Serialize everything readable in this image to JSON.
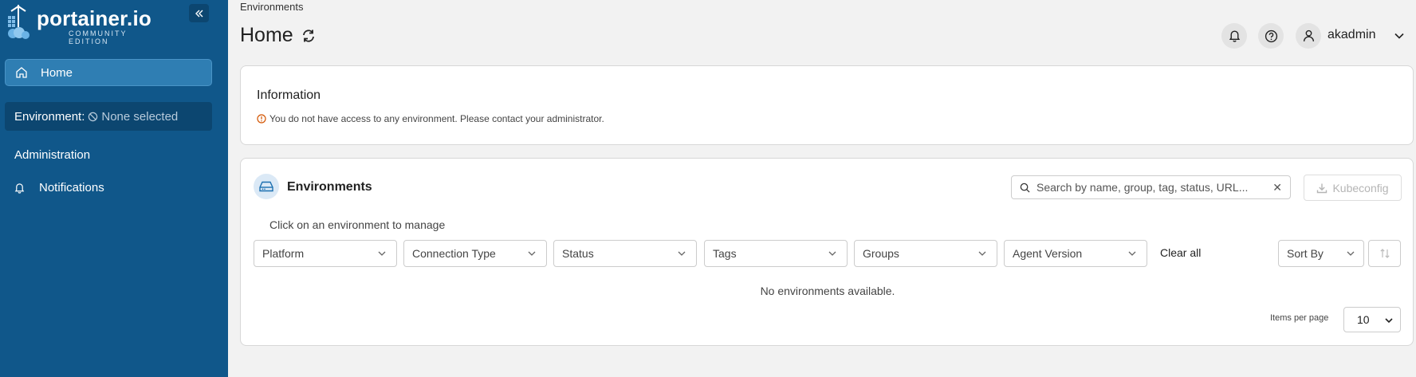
{
  "app": {
    "logo_text": "portainer.io",
    "logo_sub": "COMMUNITY EDITION"
  },
  "colors": {
    "sidebar_bg": "#10578a",
    "sidebar_active": "#2f7eb3",
    "env_box_bg": "#0c4670",
    "page_bg": "#f2f2f2",
    "card_bg": "#ffffff",
    "warning": "#d35400"
  },
  "sidebar": {
    "collapse_icon": "chevrons-left-icon",
    "home": {
      "label": "Home",
      "icon": "home-icon"
    },
    "environment": {
      "label": "Environment:",
      "value": "None selected",
      "icon": "ban-icon"
    },
    "admin_title": "Administration",
    "notifications": {
      "label": "Notifications",
      "icon": "bell-icon"
    }
  },
  "header": {
    "breadcrumb": "Environments",
    "title": "Home",
    "refresh_icon": "refresh-icon",
    "username": "akadmin",
    "icons": [
      "bell-icon",
      "help-icon",
      "user-icon",
      "chevron-down-icon"
    ]
  },
  "info_card": {
    "title": "Information",
    "message": "You do not have access to any environment. Please contact your administrator."
  },
  "environments": {
    "title": "Environments",
    "search_placeholder": "Search by name, group, tag, status, URL...",
    "kubeconfig_label": "Kubeconfig",
    "manage_text": "Click on an environment to manage",
    "filters": [
      "Platform",
      "Connection Type",
      "Status",
      "Tags",
      "Groups",
      "Agent Version"
    ],
    "clear_all": "Clear all",
    "sort_by": "Sort By",
    "empty_message": "No environments available.",
    "items_per_page_label": "Items per page",
    "items_per_page_value": "10"
  }
}
